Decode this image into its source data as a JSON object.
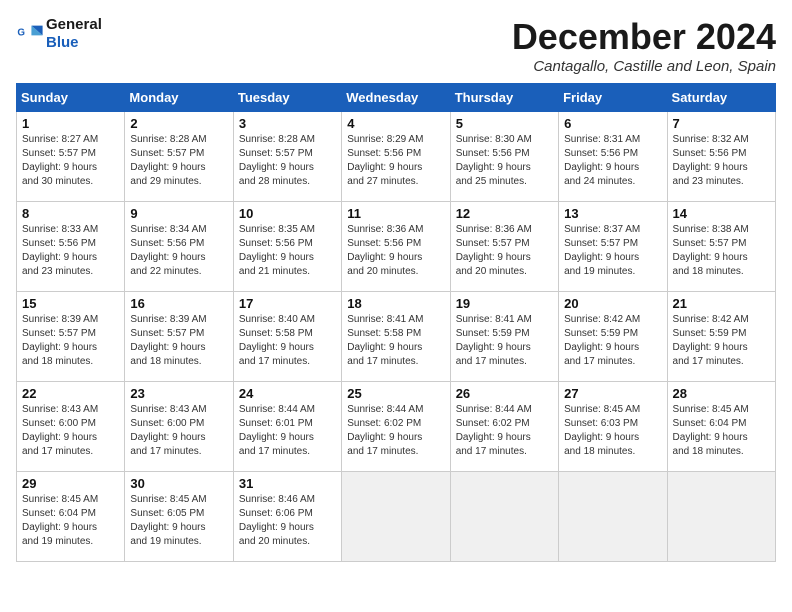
{
  "header": {
    "logo_line1": "General",
    "logo_line2": "Blue",
    "month_title": "December 2024",
    "location": "Cantagallo, Castille and Leon, Spain"
  },
  "columns": [
    "Sunday",
    "Monday",
    "Tuesday",
    "Wednesday",
    "Thursday",
    "Friday",
    "Saturday"
  ],
  "weeks": [
    [
      {
        "day": "1",
        "info": "Sunrise: 8:27 AM\nSunset: 5:57 PM\nDaylight: 9 hours\nand 30 minutes."
      },
      {
        "day": "2",
        "info": "Sunrise: 8:28 AM\nSunset: 5:57 PM\nDaylight: 9 hours\nand 29 minutes."
      },
      {
        "day": "3",
        "info": "Sunrise: 8:28 AM\nSunset: 5:57 PM\nDaylight: 9 hours\nand 28 minutes."
      },
      {
        "day": "4",
        "info": "Sunrise: 8:29 AM\nSunset: 5:56 PM\nDaylight: 9 hours\nand 27 minutes."
      },
      {
        "day": "5",
        "info": "Sunrise: 8:30 AM\nSunset: 5:56 PM\nDaylight: 9 hours\nand 25 minutes."
      },
      {
        "day": "6",
        "info": "Sunrise: 8:31 AM\nSunset: 5:56 PM\nDaylight: 9 hours\nand 24 minutes."
      },
      {
        "day": "7",
        "info": "Sunrise: 8:32 AM\nSunset: 5:56 PM\nDaylight: 9 hours\nand 23 minutes."
      }
    ],
    [
      {
        "day": "8",
        "info": "Sunrise: 8:33 AM\nSunset: 5:56 PM\nDaylight: 9 hours\nand 23 minutes."
      },
      {
        "day": "9",
        "info": "Sunrise: 8:34 AM\nSunset: 5:56 PM\nDaylight: 9 hours\nand 22 minutes."
      },
      {
        "day": "10",
        "info": "Sunrise: 8:35 AM\nSunset: 5:56 PM\nDaylight: 9 hours\nand 21 minutes."
      },
      {
        "day": "11",
        "info": "Sunrise: 8:36 AM\nSunset: 5:56 PM\nDaylight: 9 hours\nand 20 minutes."
      },
      {
        "day": "12",
        "info": "Sunrise: 8:36 AM\nSunset: 5:57 PM\nDaylight: 9 hours\nand 20 minutes."
      },
      {
        "day": "13",
        "info": "Sunrise: 8:37 AM\nSunset: 5:57 PM\nDaylight: 9 hours\nand 19 minutes."
      },
      {
        "day": "14",
        "info": "Sunrise: 8:38 AM\nSunset: 5:57 PM\nDaylight: 9 hours\nand 18 minutes."
      }
    ],
    [
      {
        "day": "15",
        "info": "Sunrise: 8:39 AM\nSunset: 5:57 PM\nDaylight: 9 hours\nand 18 minutes."
      },
      {
        "day": "16",
        "info": "Sunrise: 8:39 AM\nSunset: 5:57 PM\nDaylight: 9 hours\nand 18 minutes."
      },
      {
        "day": "17",
        "info": "Sunrise: 8:40 AM\nSunset: 5:58 PM\nDaylight: 9 hours\nand 17 minutes."
      },
      {
        "day": "18",
        "info": "Sunrise: 8:41 AM\nSunset: 5:58 PM\nDaylight: 9 hours\nand 17 minutes."
      },
      {
        "day": "19",
        "info": "Sunrise: 8:41 AM\nSunset: 5:59 PM\nDaylight: 9 hours\nand 17 minutes."
      },
      {
        "day": "20",
        "info": "Sunrise: 8:42 AM\nSunset: 5:59 PM\nDaylight: 9 hours\nand 17 minutes."
      },
      {
        "day": "21",
        "info": "Sunrise: 8:42 AM\nSunset: 5:59 PM\nDaylight: 9 hours\nand 17 minutes."
      }
    ],
    [
      {
        "day": "22",
        "info": "Sunrise: 8:43 AM\nSunset: 6:00 PM\nDaylight: 9 hours\nand 17 minutes."
      },
      {
        "day": "23",
        "info": "Sunrise: 8:43 AM\nSunset: 6:00 PM\nDaylight: 9 hours\nand 17 minutes."
      },
      {
        "day": "24",
        "info": "Sunrise: 8:44 AM\nSunset: 6:01 PM\nDaylight: 9 hours\nand 17 minutes."
      },
      {
        "day": "25",
        "info": "Sunrise: 8:44 AM\nSunset: 6:02 PM\nDaylight: 9 hours\nand 17 minutes."
      },
      {
        "day": "26",
        "info": "Sunrise: 8:44 AM\nSunset: 6:02 PM\nDaylight: 9 hours\nand 17 minutes."
      },
      {
        "day": "27",
        "info": "Sunrise: 8:45 AM\nSunset: 6:03 PM\nDaylight: 9 hours\nand 18 minutes."
      },
      {
        "day": "28",
        "info": "Sunrise: 8:45 AM\nSunset: 6:04 PM\nDaylight: 9 hours\nand 18 minutes."
      }
    ],
    [
      {
        "day": "29",
        "info": "Sunrise: 8:45 AM\nSunset: 6:04 PM\nDaylight: 9 hours\nand 19 minutes."
      },
      {
        "day": "30",
        "info": "Sunrise: 8:45 AM\nSunset: 6:05 PM\nDaylight: 9 hours\nand 19 minutes."
      },
      {
        "day": "31",
        "info": "Sunrise: 8:46 AM\nSunset: 6:06 PM\nDaylight: 9 hours\nand 20 minutes."
      },
      {
        "day": "",
        "info": ""
      },
      {
        "day": "",
        "info": ""
      },
      {
        "day": "",
        "info": ""
      },
      {
        "day": "",
        "info": ""
      }
    ]
  ]
}
